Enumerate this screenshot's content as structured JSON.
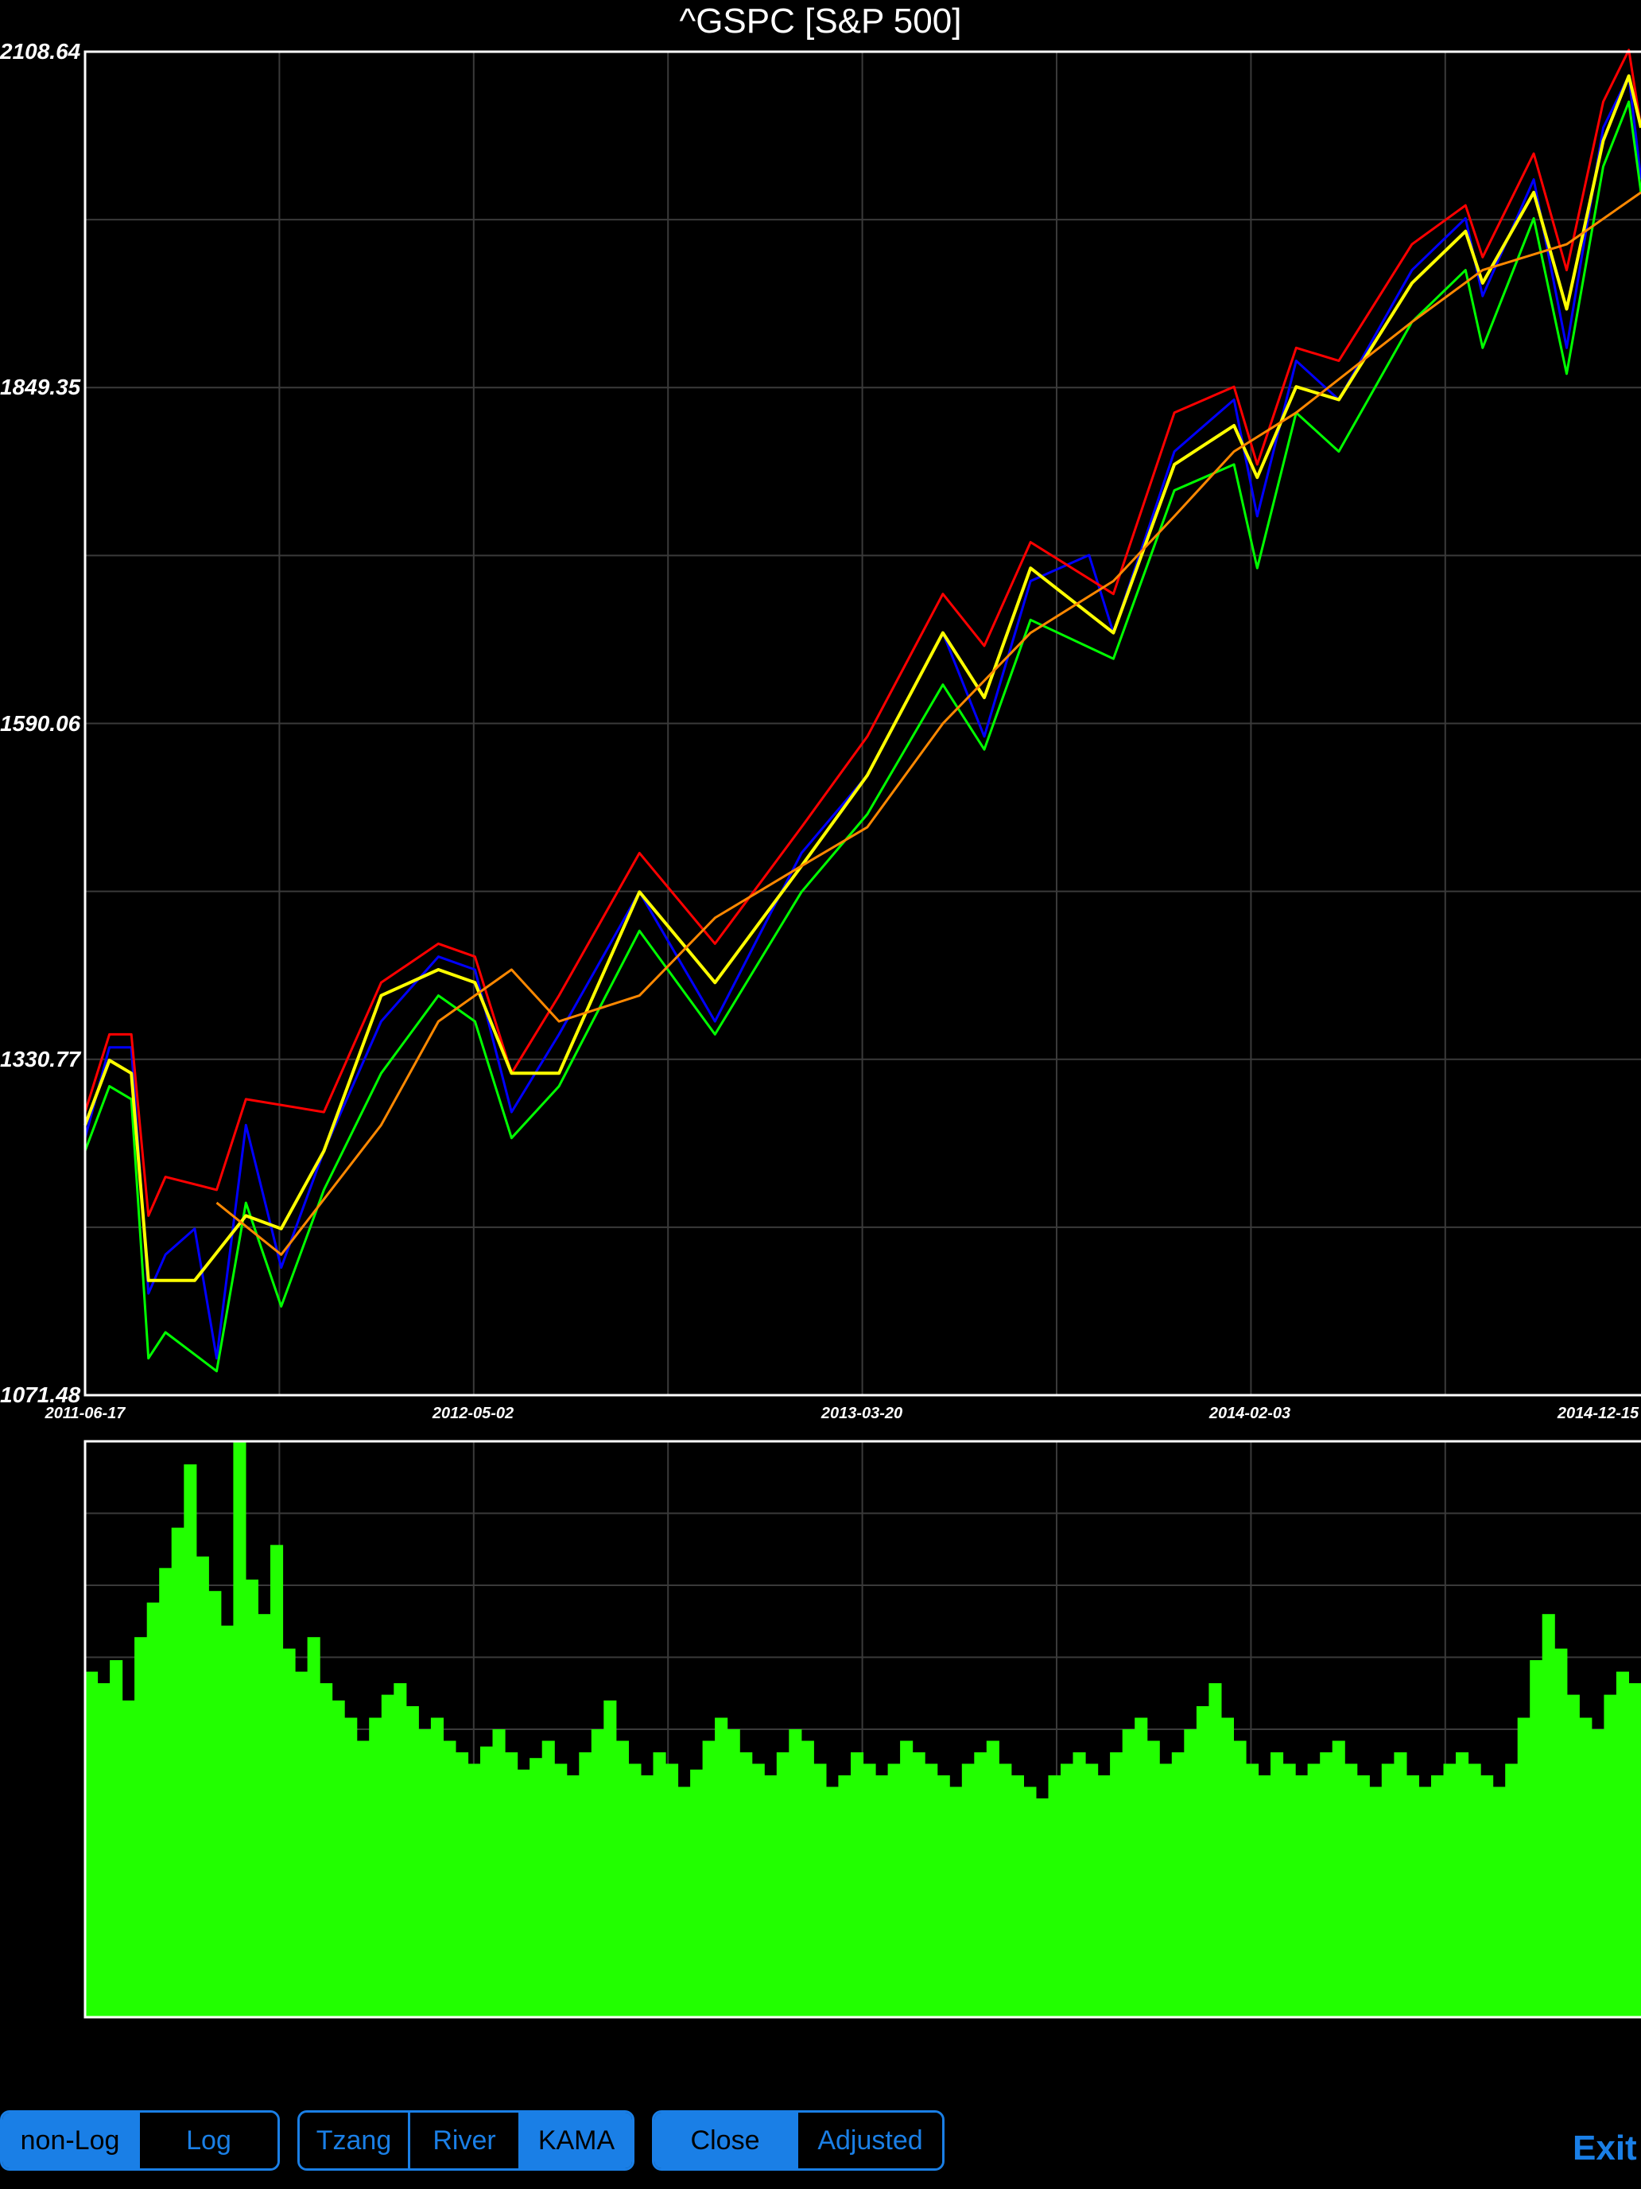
{
  "chart_title": "^GSPC [S&P 500]",
  "colors": {
    "background": "#000000",
    "frame": "#ffffff",
    "grid": "#3a3a3a",
    "price": "#0000ff",
    "upper_band": "#ff0000",
    "lower_band": "#00ff00",
    "kama": "#ffff00",
    "slow_ma": "#ff8800",
    "volume": "#22ff00",
    "button_accent": "#1a7fe6"
  },
  "controls": {
    "scale": [
      {
        "label": "non-Log",
        "selected": true
      },
      {
        "label": "Log",
        "selected": false
      }
    ],
    "indicator": [
      {
        "label": "Tzang",
        "selected": false
      },
      {
        "label": "River",
        "selected": false
      },
      {
        "label": "KAMA",
        "selected": true
      }
    ],
    "price_type": [
      {
        "label": "Close",
        "selected": true
      },
      {
        "label": "Adjusted",
        "selected": false
      }
    ],
    "exit_label": "Exit"
  },
  "chart_data": [
    {
      "type": "line",
      "y_ticks": [
        "2108.64",
        "1849.35",
        "1590.06",
        "1330.77",
        "1071.48"
      ],
      "x_ticks": [
        "2011-06-17",
        "2012-05-02",
        "2013-03-20",
        "2014-02-03",
        "2014-12-15"
      ],
      "ylim": [
        1071.48,
        2108.64
      ],
      "xlim": [
        "2011-06-17",
        "2014-12-15"
      ],
      "grid": true,
      "series": [
        {
          "color": "#0000ff",
          "dates": [
            "2011-06-17",
            "2011-07-07",
            "2011-07-25",
            "2011-08-08",
            "2011-08-22",
            "2011-09-15",
            "2011-10-03",
            "2011-10-27",
            "2011-11-25",
            "2011-12-30",
            "2012-02-15",
            "2012-04-02",
            "2012-05-02",
            "2012-06-01",
            "2012-07-10",
            "2012-09-14",
            "2012-11-15",
            "2013-01-25",
            "2013-03-20",
            "2013-05-21",
            "2013-06-24",
            "2013-08-01",
            "2013-09-18",
            "2013-10-08",
            "2013-11-27",
            "2014-01-15",
            "2014-02-03",
            "2014-03-07",
            "2014-04-11",
            "2014-06-10",
            "2014-07-24",
            "2014-08-07",
            "2014-09-18",
            "2014-10-15",
            "2014-11-14",
            "2014-12-05",
            "2014-12-15"
          ],
          "values": [
            1270,
            1340,
            1340,
            1150,
            1180,
            1200,
            1100,
            1280,
            1170,
            1260,
            1360,
            1410,
            1400,
            1290,
            1350,
            1460,
            1360,
            1490,
            1550,
            1660,
            1580,
            1700,
            1720,
            1660,
            1800,
            1840,
            1750,
            1870,
            1840,
            1940,
            1980,
            1920,
            2010,
            1880,
            2050,
            2090,
            2010
          ]
        },
        {
          "color": "#ff0000",
          "dates": [
            "2011-06-17",
            "2011-07-07",
            "2011-07-25",
            "2011-08-08",
            "2011-08-22",
            "2011-10-03",
            "2011-10-27",
            "2011-12-30",
            "2012-02-15",
            "2012-04-02",
            "2012-05-02",
            "2012-06-01",
            "2012-07-10",
            "2012-09-14",
            "2012-11-15",
            "2013-01-25",
            "2013-03-20",
            "2013-05-21",
            "2013-06-24",
            "2013-08-01",
            "2013-10-08",
            "2013-11-27",
            "2014-01-15",
            "2014-02-03",
            "2014-03-07",
            "2014-04-11",
            "2014-06-10",
            "2014-07-24",
            "2014-08-07",
            "2014-09-18",
            "2014-10-15",
            "2014-11-14",
            "2014-12-05",
            "2014-12-15"
          ],
          "values": [
            1290,
            1350,
            1350,
            1210,
            1240,
            1230,
            1300,
            1290,
            1390,
            1420,
            1410,
            1320,
            1380,
            1490,
            1420,
            1510,
            1580,
            1690,
            1650,
            1730,
            1690,
            1830,
            1850,
            1790,
            1880,
            1870,
            1960,
            1990,
            1950,
            2030,
            1940,
            2070,
            2110,
            2050
          ]
        },
        {
          "color": "#00ff00",
          "dates": [
            "2011-06-17",
            "2011-07-07",
            "2011-07-25",
            "2011-08-08",
            "2011-08-22",
            "2011-10-03",
            "2011-10-27",
            "2011-11-25",
            "2011-12-30",
            "2012-02-15",
            "2012-04-02",
            "2012-05-02",
            "2012-06-01",
            "2012-07-10",
            "2012-09-14",
            "2012-11-15",
            "2013-01-25",
            "2013-03-20",
            "2013-05-21",
            "2013-06-24",
            "2013-08-01",
            "2013-10-08",
            "2013-11-27",
            "2014-01-15",
            "2014-02-03",
            "2014-03-07",
            "2014-04-11",
            "2014-06-10",
            "2014-07-24",
            "2014-08-07",
            "2014-09-18",
            "2014-10-15",
            "2014-11-14",
            "2014-12-05",
            "2014-12-15"
          ],
          "values": [
            1260,
            1310,
            1300,
            1100,
            1120,
            1090,
            1220,
            1140,
            1230,
            1320,
            1380,
            1360,
            1270,
            1310,
            1430,
            1350,
            1460,
            1520,
            1620,
            1570,
            1670,
            1640,
            1770,
            1790,
            1710,
            1830,
            1800,
            1900,
            1940,
            1880,
            1980,
            1860,
            2020,
            2070,
            2000
          ]
        },
        {
          "color": "#ffff00",
          "dates": [
            "2011-06-17",
            "2011-07-07",
            "2011-07-25",
            "2011-08-08",
            "2011-09-15",
            "2011-10-27",
            "2011-11-25",
            "2011-12-30",
            "2012-02-15",
            "2012-04-02",
            "2012-05-02",
            "2012-06-01",
            "2012-07-10",
            "2012-09-14",
            "2012-11-15",
            "2013-01-25",
            "2013-03-20",
            "2013-05-21",
            "2013-06-24",
            "2013-08-01",
            "2013-10-08",
            "2013-11-27",
            "2014-01-15",
            "2014-02-03",
            "2014-03-07",
            "2014-04-11",
            "2014-06-10",
            "2014-07-24",
            "2014-08-07",
            "2014-09-18",
            "2014-10-15",
            "2014-11-14",
            "2014-12-05",
            "2014-12-15"
          ],
          "values": [
            1280,
            1330,
            1320,
            1160,
            1160,
            1210,
            1200,
            1260,
            1380,
            1400,
            1390,
            1320,
            1320,
            1460,
            1390,
            1480,
            1550,
            1660,
            1610,
            1710,
            1660,
            1790,
            1820,
            1780,
            1850,
            1840,
            1930,
            1970,
            1930,
            2000,
            1910,
            2040,
            2090,
            2050
          ]
        },
        {
          "color": "#ff8800",
          "dates": [
            "2011-10-03",
            "2011-11-25",
            "2012-02-15",
            "2012-04-02",
            "2012-06-01",
            "2012-07-10",
            "2012-09-14",
            "2012-11-15",
            "2013-01-25",
            "2013-03-20",
            "2013-05-21",
            "2013-08-01",
            "2013-10-08",
            "2013-11-27",
            "2014-01-15",
            "2014-03-07",
            "2014-06-10",
            "2014-08-07",
            "2014-10-15",
            "2014-12-15"
          ],
          "values": [
            1220,
            1180,
            1280,
            1360,
            1400,
            1360,
            1380,
            1440,
            1480,
            1510,
            1590,
            1660,
            1700,
            1750,
            1800,
            1830,
            1900,
            1940,
            1960,
            2000
          ]
        }
      ]
    },
    {
      "type": "bar",
      "series": [
        {
          "color": "#22ff00",
          "values": [
            0.6,
            0.58,
            0.62,
            0.55,
            0.66,
            0.72,
            0.78,
            0.85,
            0.96,
            0.8,
            0.74,
            0.68,
            1.0,
            0.76,
            0.7,
            0.82,
            0.64,
            0.6,
            0.66,
            0.58,
            0.55,
            0.52,
            0.48,
            0.52,
            0.56,
            0.58,
            0.54,
            0.5,
            0.52,
            0.48,
            0.46,
            0.44,
            0.47,
            0.5,
            0.46,
            0.43,
            0.45,
            0.48,
            0.44,
            0.42,
            0.46,
            0.5,
            0.55,
            0.48,
            0.44,
            0.42,
            0.46,
            0.44,
            0.4,
            0.43,
            0.48,
            0.52,
            0.5,
            0.46,
            0.44,
            0.42,
            0.46,
            0.5,
            0.48,
            0.44,
            0.4,
            0.42,
            0.46,
            0.44,
            0.42,
            0.44,
            0.48,
            0.46,
            0.44,
            0.42,
            0.4,
            0.44,
            0.46,
            0.48,
            0.44,
            0.42,
            0.4,
            0.38,
            0.42,
            0.44,
            0.46,
            0.44,
            0.42,
            0.46,
            0.5,
            0.52,
            0.48,
            0.44,
            0.46,
            0.5,
            0.54,
            0.58,
            0.52,
            0.48,
            0.44,
            0.42,
            0.46,
            0.44,
            0.42,
            0.44,
            0.46,
            0.48,
            0.44,
            0.42,
            0.4,
            0.44,
            0.46,
            0.42,
            0.4,
            0.42,
            0.44,
            0.46,
            0.44,
            0.42,
            0.4,
            0.44,
            0.52,
            0.62,
            0.7,
            0.64,
            0.56,
            0.52,
            0.5,
            0.56,
            0.6,
            0.58
          ]
        }
      ]
    }
  ]
}
